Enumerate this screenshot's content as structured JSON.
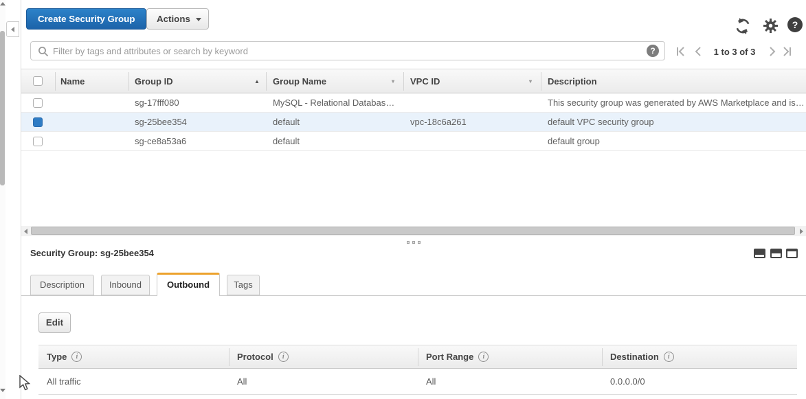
{
  "toolbar": {
    "create_label": "Create Security Group",
    "actions_label": "Actions"
  },
  "filter": {
    "placeholder": "Filter by tags and attributes or search by keyword"
  },
  "pagination": {
    "range_label": "1 to 3 of 3"
  },
  "icons": {
    "help_glyph": "?",
    "info_glyph": "i",
    "sort_asc_glyph": "▲",
    "dropdown_glyph": "▾"
  },
  "colors": {
    "accent_blue": "#1f72b8",
    "selected_row": "#e9f2fb",
    "active_tab_border": "#eca22d"
  },
  "groups_table": {
    "columns": [
      {
        "label": "Name"
      },
      {
        "label": "Group ID"
      },
      {
        "label": "Group Name"
      },
      {
        "label": "VPC ID"
      },
      {
        "label": "Description"
      }
    ],
    "sorted_by": "Group ID",
    "rows": [
      {
        "selected": false,
        "name": "",
        "group_id": "sg-17fff080",
        "group_name": "MySQL - Relational Databas…",
        "vpc_id": "",
        "description": "This security group was generated by AWS Marketplace and is…"
      },
      {
        "selected": true,
        "name": "",
        "group_id": "sg-25bee354",
        "group_name": "default",
        "vpc_id": "vpc-18c6a261",
        "description": "default VPC security group"
      },
      {
        "selected": false,
        "name": "",
        "group_id": "sg-ce8a53a6",
        "group_name": "default",
        "vpc_id": "",
        "description": "default group"
      }
    ]
  },
  "detail_panel": {
    "title": "Security Group: sg-25bee354",
    "tabs": [
      {
        "label": "Description",
        "active": false
      },
      {
        "label": "Inbound",
        "active": false
      },
      {
        "label": "Outbound",
        "active": true
      },
      {
        "label": "Tags",
        "active": false
      }
    ],
    "edit_label": "Edit",
    "rules_table": {
      "columns": [
        {
          "label": "Type"
        },
        {
          "label": "Protocol"
        },
        {
          "label": "Port Range"
        },
        {
          "label": "Destination"
        }
      ],
      "rows": [
        {
          "type": "All traffic",
          "protocol": "All",
          "port_range": "All",
          "destination": "0.0.0.0/0"
        }
      ]
    }
  }
}
